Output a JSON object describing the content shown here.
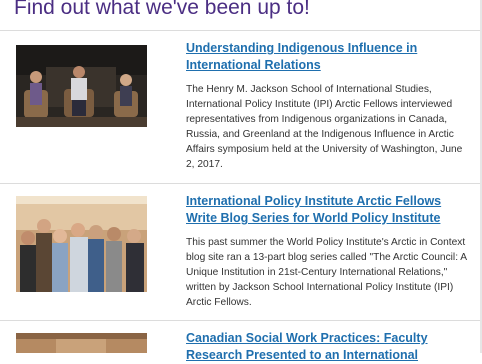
{
  "section": {
    "title": "Find out what we've been up to!"
  },
  "articles": [
    {
      "headline": "Understanding Indigenous Influence in International Relations",
      "summary": "The Henry M. Jackson School of International Studies, International Policy Institute (IPI) Arctic Fellows interviewed representatives from Indigenous organizations in Canada, Russia, and Greenland at the Indigenous Influence in Arctic Affairs symposium held at the University of Washington, June 2, 2017."
    },
    {
      "headline": "International Policy Institute Arctic Fellows Write Blog Series for World Policy Institute",
      "summary": "This past summer the World Policy Institute's Arctic in Context blog site ran a 13-part blog series called \"The Arctic Council: A Unique Institution in 21st-Century International Relations,\" written by Jackson School International Policy Institute (IPI) Arctic Fellows."
    },
    {
      "headline": "Canadian Social Work Practices: Faculty Research Presented to an International"
    }
  ],
  "colors": {
    "title": "#4b2e83",
    "link": "#1f6fae",
    "text": "#333333",
    "divider": "#dcdcdc"
  }
}
